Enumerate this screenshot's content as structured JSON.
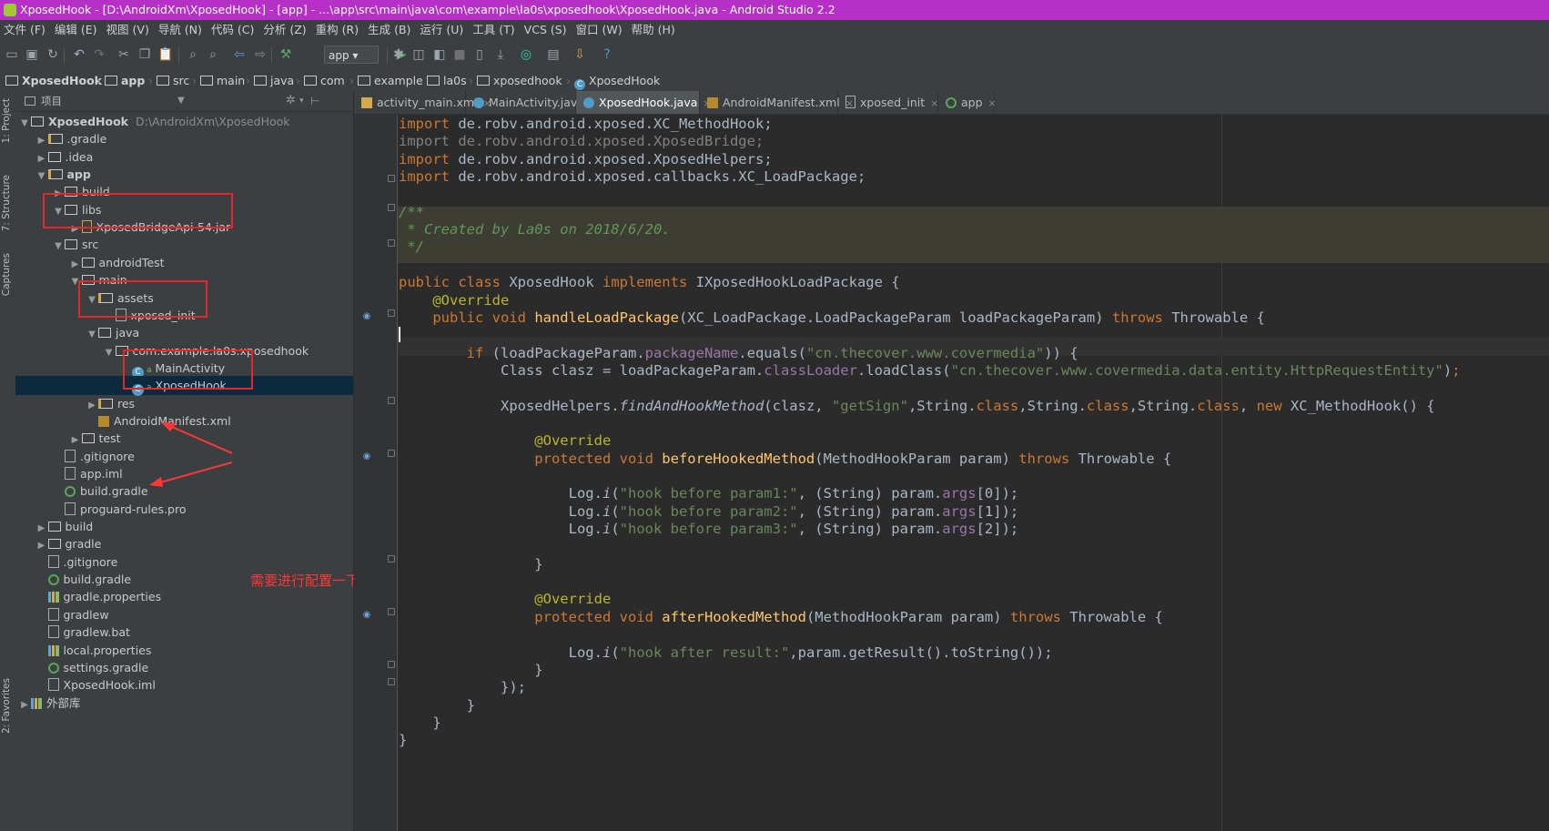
{
  "window": {
    "title": "XposedHook - [D:\\AndroidXm\\XposedHook] - [app] - ...\\app\\src\\main\\java\\com\\example\\la0s\\xposedhook\\XposedHook.java - Android Studio 2.2"
  },
  "menu": [
    "文件 (F)",
    "编辑 (E)",
    "视图 (V)",
    "导航 (N)",
    "代码 (C)",
    "分析 (Z)",
    "重构 (R)",
    "生成 (B)",
    "运行 (U)",
    "工具 (T)",
    "VCS (S)",
    "窗口 (W)",
    "帮助 (H)"
  ],
  "toolbar": {
    "run_config": "app",
    "icons": [
      "open-icon",
      "save-icon",
      "sync-icon",
      "undo-icon",
      "redo-icon",
      "cut-icon",
      "copy-icon",
      "paste-icon",
      "find-icon",
      "replace-icon",
      "back-icon",
      "forward-icon",
      "build-icon",
      "run-icon",
      "debug-icon",
      "attach-icon",
      "coverage-icon",
      "stop-icon",
      "avd-icon",
      "sdk-icon",
      "gradle-sync-icon",
      "structure-icon",
      "device-monitor-icon",
      "help-icon"
    ]
  },
  "breadcrumbs": [
    "XposedHook",
    "app",
    "src",
    "main",
    "java",
    "com",
    "example",
    "la0s",
    "xposedhook",
    "XposedHook"
  ],
  "left_tool_windows": [
    "1: Project",
    "7: Structure",
    "Captures",
    "2: Favorites"
  ],
  "project_panel": {
    "header": "项目",
    "root_path": "D:\\AndroidXm\\XposedHook",
    "tree": [
      {
        "label": "XposedHook",
        "indent": 0,
        "arrow": "open",
        "icon": "module",
        "bold": true
      },
      {
        "label": ".gradle",
        "indent": 1,
        "arrow": "closed",
        "icon": "folder-mod"
      },
      {
        "label": ".idea",
        "indent": 1,
        "arrow": "closed",
        "icon": "folder"
      },
      {
        "label": "app",
        "indent": 1,
        "arrow": "open",
        "icon": "folder-mod",
        "bold": true
      },
      {
        "label": "build",
        "indent": 2,
        "arrow": "closed",
        "icon": "folder"
      },
      {
        "label": "libs",
        "indent": 2,
        "arrow": "open",
        "icon": "folder"
      },
      {
        "label": "XposedBridgeApi-54.jar",
        "indent": 3,
        "arrow": "closed",
        "icon": "jar"
      },
      {
        "label": "src",
        "indent": 2,
        "arrow": "open",
        "icon": "folder"
      },
      {
        "label": "androidTest",
        "indent": 3,
        "arrow": "closed",
        "icon": "folder"
      },
      {
        "label": "main",
        "indent": 3,
        "arrow": "open",
        "icon": "folder"
      },
      {
        "label": "assets",
        "indent": 4,
        "arrow": "open",
        "icon": "folder-mod"
      },
      {
        "label": "xposed_init",
        "indent": 5,
        "arrow": "none",
        "icon": "file"
      },
      {
        "label": "java",
        "indent": 4,
        "arrow": "open",
        "icon": "folder"
      },
      {
        "label": "com.example.la0s.xposedhook",
        "indent": 5,
        "arrow": "open",
        "icon": "folder"
      },
      {
        "label": "MainActivity",
        "indent": 6,
        "arrow": "none",
        "icon": "class"
      },
      {
        "label": "XposedHook",
        "indent": 6,
        "arrow": "none",
        "icon": "class",
        "selected": true
      },
      {
        "label": "res",
        "indent": 4,
        "arrow": "closed",
        "icon": "folder-mod"
      },
      {
        "label": "AndroidManifest.xml",
        "indent": 4,
        "arrow": "none",
        "icon": "manifest"
      },
      {
        "label": "test",
        "indent": 3,
        "arrow": "closed",
        "icon": "folder"
      },
      {
        "label": ".gitignore",
        "indent": 2,
        "arrow": "none",
        "icon": "file"
      },
      {
        "label": "app.iml",
        "indent": 2,
        "arrow": "none",
        "icon": "file"
      },
      {
        "label": "build.gradle",
        "indent": 2,
        "arrow": "none",
        "icon": "gradle"
      },
      {
        "label": "proguard-rules.pro",
        "indent": 2,
        "arrow": "none",
        "icon": "file"
      },
      {
        "label": "build",
        "indent": 1,
        "arrow": "closed",
        "icon": "folder"
      },
      {
        "label": "gradle",
        "indent": 1,
        "arrow": "closed",
        "icon": "folder"
      },
      {
        "label": ".gitignore",
        "indent": 1,
        "arrow": "none",
        "icon": "file"
      },
      {
        "label": "build.gradle",
        "indent": 1,
        "arrow": "none",
        "icon": "gradle"
      },
      {
        "label": "gradle.properties",
        "indent": 1,
        "arrow": "none",
        "icon": "props"
      },
      {
        "label": "gradlew",
        "indent": 1,
        "arrow": "none",
        "icon": "file"
      },
      {
        "label": "gradlew.bat",
        "indent": 1,
        "arrow": "none",
        "icon": "file"
      },
      {
        "label": "local.properties",
        "indent": 1,
        "arrow": "none",
        "icon": "props"
      },
      {
        "label": "settings.gradle",
        "indent": 1,
        "arrow": "none",
        "icon": "gradle"
      },
      {
        "label": "XposedHook.iml",
        "indent": 1,
        "arrow": "none",
        "icon": "file"
      },
      {
        "label": "外部库",
        "indent": 0,
        "arrow": "closed",
        "icon": "libs"
      }
    ],
    "annotation": "需要进行配置一下"
  },
  "editor": {
    "tabs": [
      {
        "label": "activity_main.xml",
        "icon": "xml",
        "active": false
      },
      {
        "label": "MainActivity.java",
        "icon": "class",
        "active": false
      },
      {
        "label": "XposedHook.java",
        "icon": "class",
        "active": true
      },
      {
        "label": "AndroidManifest.xml",
        "icon": "manifest",
        "active": false
      },
      {
        "label": "xposed_init",
        "icon": "file",
        "active": false
      },
      {
        "label": "app",
        "icon": "gradle",
        "active": false
      }
    ],
    "lines": [
      [
        [
          "kw",
          "import "
        ],
        [
          "",
          "de.robv.android.xposed.XC_MethodHook;"
        ]
      ],
      [
        [
          "gy",
          "import de.robv.android.xposed.XposedBridge;"
        ]
      ],
      [
        [
          "kw",
          "import "
        ],
        [
          "",
          "de.robv.android.xposed.XposedHelpers;"
        ]
      ],
      [
        [
          "kw",
          "import "
        ],
        [
          "",
          "de.robv.android.xposed.callbacks.XC_LoadPackage;"
        ]
      ],
      [],
      [
        [
          "cm",
          "/**"
        ]
      ],
      [
        [
          "cm",
          " * Created by La0s on 2018/6/20."
        ]
      ],
      [
        [
          "cm",
          " */"
        ]
      ],
      [],
      [
        [
          "kw",
          "public class "
        ],
        [
          "",
          "XposedHook "
        ],
        [
          "kw",
          "implements "
        ],
        [
          "",
          "IXposedHookLoadPackage {"
        ]
      ],
      [
        [
          "an",
          "    @Override"
        ]
      ],
      [
        [
          "kw",
          "    public void "
        ],
        [
          "fn",
          "handleLoadPackage"
        ],
        [
          "",
          "(XC_LoadPackage.LoadPackageParam loadPackageParam) "
        ],
        [
          "kw",
          "throws "
        ],
        [
          "",
          "Throwable {"
        ]
      ],
      [
        [
          "caret",
          ""
        ]
      ],
      [
        [
          "kw",
          "        if "
        ],
        [
          "",
          "(loadPackageParam."
        ],
        [
          "fd",
          "packageName"
        ],
        [
          "",
          ".equals("
        ],
        [
          "st",
          "\"cn.thecover.www.covermedia\""
        ],
        [
          "",
          "))"
        ],
        [
          "",
          " {"
        ]
      ],
      [
        [
          "",
          "            Class clasz = loadPackageParam."
        ],
        [
          "fd",
          "classLoader"
        ],
        [
          "",
          ".loadClass("
        ],
        [
          "st",
          "\"cn.thecover.www.covermedia.data.entity.HttpRequestEntity\""
        ],
        [
          "",
          ")"
        ],
        [
          "kw",
          ";"
        ]
      ],
      [],
      [
        [
          "",
          "            XposedHelpers."
        ],
        [
          "it",
          "findAndHookMethod"
        ],
        [
          "",
          "(clasz, "
        ],
        [
          "st",
          "\"getSign\""
        ],
        [
          "",
          ",String."
        ],
        [
          "kw",
          "class"
        ],
        [
          "",
          ",String."
        ],
        [
          "kw",
          "class"
        ],
        [
          "",
          ",String."
        ],
        [
          "kw",
          "class"
        ],
        [
          "",
          ", "
        ],
        [
          "kw",
          "new "
        ],
        [
          "",
          "XC_MethodHook() {"
        ]
      ],
      [],
      [
        [
          "an",
          "                @Override"
        ]
      ],
      [
        [
          "kw",
          "                protected void "
        ],
        [
          "fn",
          "beforeHookedMethod"
        ],
        [
          "",
          "(MethodHookParam param) "
        ],
        [
          "kw",
          "throws "
        ],
        [
          "",
          "Throwable {"
        ]
      ],
      [],
      [
        [
          "",
          "                    Log."
        ],
        [
          "it",
          "i"
        ],
        [
          "",
          "("
        ],
        [
          "st",
          "\"hook before param1:\""
        ],
        [
          "",
          ", (String) param."
        ],
        [
          "fd",
          "args"
        ],
        [
          "",
          "[0]);"
        ]
      ],
      [
        [
          "",
          "                    Log."
        ],
        [
          "it",
          "i"
        ],
        [
          "",
          "("
        ],
        [
          "st",
          "\"hook before param2:\""
        ],
        [
          "",
          ", (String) param."
        ],
        [
          "fd",
          "args"
        ],
        [
          "",
          "[1]);"
        ]
      ],
      [
        [
          "",
          "                    Log."
        ],
        [
          "it",
          "i"
        ],
        [
          "",
          "("
        ],
        [
          "st",
          "\"hook before param3:\""
        ],
        [
          "",
          ", (String) param."
        ],
        [
          "fd",
          "args"
        ],
        [
          "",
          "[2]);"
        ]
      ],
      [],
      [
        [
          "",
          "                }"
        ]
      ],
      [],
      [
        [
          "an",
          "                @Override"
        ]
      ],
      [
        [
          "kw",
          "                protected void "
        ],
        [
          "fn",
          "afterHookedMethod"
        ],
        [
          "",
          "(MethodHookParam param) "
        ],
        [
          "kw",
          "throws "
        ],
        [
          "",
          "Throwable {"
        ]
      ],
      [],
      [
        [
          "",
          "                    Log."
        ],
        [
          "it",
          "i"
        ],
        [
          "",
          "("
        ],
        [
          "st",
          "\"hook after result:\""
        ],
        [
          "",
          ",param.getResult().toString());"
        ]
      ],
      [
        [
          "",
          "                }"
        ]
      ],
      [
        [
          "",
          "            });"
        ]
      ],
      [
        [
          "",
          "        }"
        ]
      ],
      [
        [
          "",
          "    }"
        ]
      ],
      [
        [
          "",
          "}"
        ]
      ]
    ]
  }
}
